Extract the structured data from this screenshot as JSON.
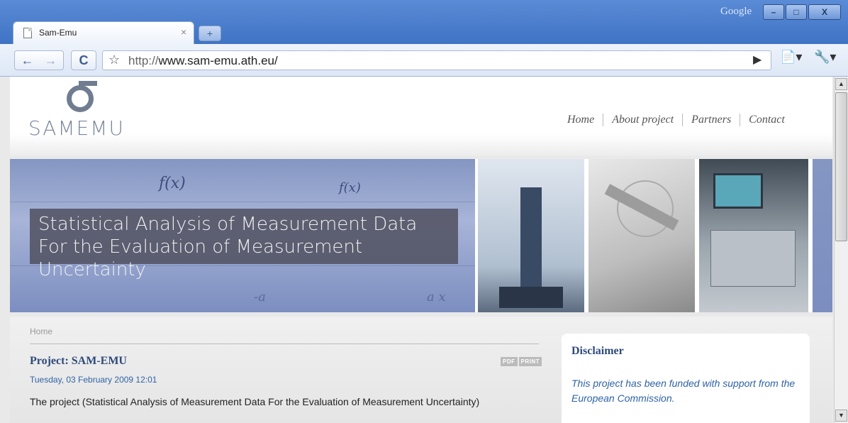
{
  "browser": {
    "brand": "Google",
    "tab": {
      "title": "Sam-Emu",
      "close": "×"
    },
    "newtab": "+",
    "url_protocol": "http://",
    "url_host": "www.sam-emu.ath.eu/",
    "window_buttons": {
      "minimize": "–",
      "maximize": "□",
      "close": "X"
    },
    "icons": [
      "page-icon",
      "back-arrow-icon",
      "forward-arrow-icon",
      "reload-icon",
      "star-icon",
      "go-arrow-icon",
      "page-menu-icon",
      "wrench-icon"
    ]
  },
  "site": {
    "logo_text": "SAMEMU",
    "nav": [
      "Home",
      "About project",
      "Partners",
      "Contact"
    ],
    "banner": {
      "formula1": "f(x)",
      "formula2": "f(x)",
      "formula3": "-a",
      "formula4": "a x",
      "line1": "Statistical Analysis of Measurement Data",
      "line2": "For the Evaluation of Measurement Uncertainty"
    },
    "breadcrumb": "Home",
    "article": {
      "title": "Project: SAM-EMU",
      "badges": [
        "PDF",
        "PRINT"
      ],
      "date": "Tuesday, 03 February 2009 12:01",
      "body": "The project (Statistical Analysis of Measurement Data For the Evaluation of Measurement Uncertainty)"
    },
    "disclaimer": {
      "title": "Disclaimer",
      "text": "This project has been funded with support from the European Commission."
    }
  },
  "colors": {
    "titlebar": "#3f73c4",
    "heading": "#2e4a7a",
    "link": "#2f63a6"
  }
}
